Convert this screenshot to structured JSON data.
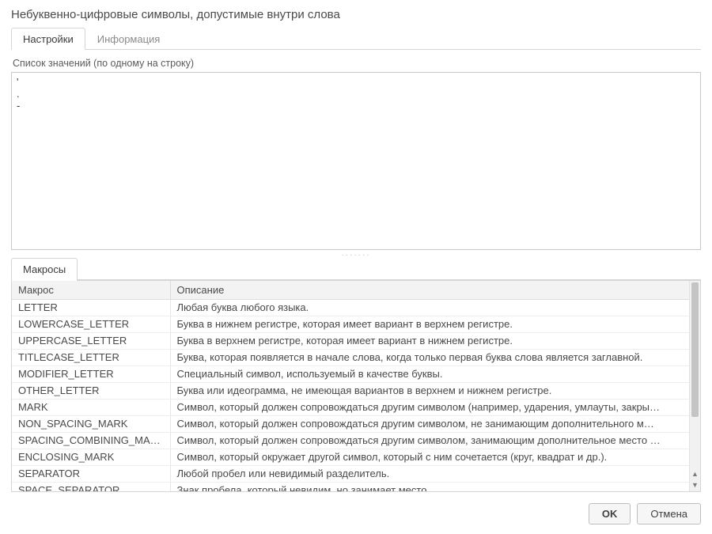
{
  "title": "Небуквенно-цифровые символы, допустимые внутри слова",
  "tabs_upper": {
    "settings": "Настройки",
    "info": "Информация"
  },
  "value_list_label": "Список значений (по одному на строку)",
  "value_list_content": "'\n.\n-",
  "tabs_lower": {
    "macros": "Макросы"
  },
  "table": {
    "headers": {
      "macro": "Макрос",
      "desc": "Описание"
    },
    "rows": [
      {
        "macro": "LETTER",
        "desc": "Любая буква любого языка."
      },
      {
        "macro": "LOWERCASE_LETTER",
        "desc": "Буква в нижнем регистре, которая имеет вариант в верхнем регистре."
      },
      {
        "macro": "UPPERCASE_LETTER",
        "desc": "Буква в верхнем регистре, которая имеет вариант в нижнем регистре."
      },
      {
        "macro": "TITLECASE_LETTER",
        "desc": "Буква, которая появляется в начале слова, когда только первая буква слова является заглавной."
      },
      {
        "macro": "MODIFIER_LETTER",
        "desc": "Специальный символ, используемый в качестве буквы."
      },
      {
        "macro": "OTHER_LETTER",
        "desc": "Буква или идеограмма, не имеющая вариантов в верхнем и нижнем регистре."
      },
      {
        "macro": "MARK",
        "desc": "Символ, который должен сопровождаться другим символом (например, ударения, умлауты, закры…"
      },
      {
        "macro": "NON_SPACING_MARK",
        "desc": "Символ, который должен сопровождаться другим символом, не занимающим дополнительного м…"
      },
      {
        "macro": "SPACING_COMBINING_MARK",
        "desc": "Символ, который должен сопровождаться другим символом, занимающим дополнительное место …"
      },
      {
        "macro": "ENCLOSING_MARK",
        "desc": "Символ, который окружает другой символ, который с ним сочетается (круг, квадрат и др.)."
      },
      {
        "macro": "SEPARATOR",
        "desc": "Любой пробел или невидимый разделитель."
      },
      {
        "macro": "SPACE_SEPARATOR",
        "desc": "Знак пробела, который невидим, но занимает место."
      }
    ]
  },
  "buttons": {
    "ok": "OK",
    "cancel": "Отмена"
  }
}
